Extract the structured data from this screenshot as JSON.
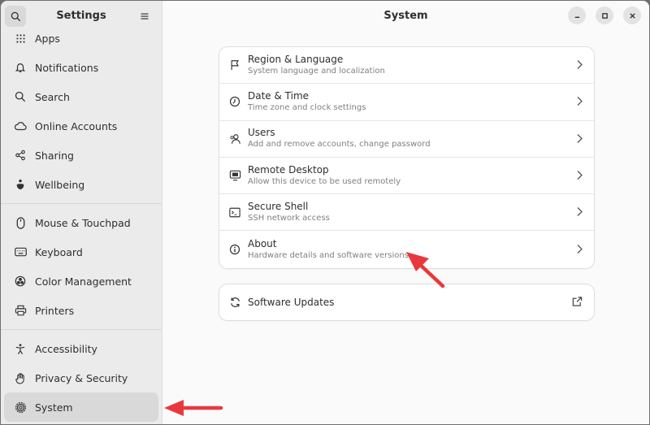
{
  "sidebar": {
    "title": "Settings",
    "items": [
      {
        "label": "Apps",
        "icon": "apps-grid-icon"
      },
      {
        "label": "Notifications",
        "icon": "bell-icon"
      },
      {
        "label": "Search",
        "icon": "search-icon"
      },
      {
        "label": "Online Accounts",
        "icon": "cloud-icon"
      },
      {
        "label": "Sharing",
        "icon": "share-icon"
      },
      {
        "label": "Wellbeing",
        "icon": "wellbeing-icon"
      },
      {
        "label": "Mouse & Touchpad",
        "icon": "mouse-icon"
      },
      {
        "label": "Keyboard",
        "icon": "keyboard-icon"
      },
      {
        "label": "Color Management",
        "icon": "color-icon"
      },
      {
        "label": "Printers",
        "icon": "printer-icon"
      },
      {
        "label": "Accessibility",
        "icon": "accessibility-icon"
      },
      {
        "label": "Privacy & Security",
        "icon": "hand-icon"
      },
      {
        "label": "System",
        "icon": "gear-icon"
      }
    ],
    "active": "System"
  },
  "main": {
    "title": "System",
    "rows": [
      {
        "title": "Region & Language",
        "subtitle": "System language and localization"
      },
      {
        "title": "Date & Time",
        "subtitle": "Time zone and clock settings"
      },
      {
        "title": "Users",
        "subtitle": "Add and remove accounts, change password"
      },
      {
        "title": "Remote Desktop",
        "subtitle": "Allow this device to be used remotely"
      },
      {
        "title": "Secure Shell",
        "subtitle": "SSH network access"
      },
      {
        "title": "About",
        "subtitle": "Hardware details and software versions"
      }
    ],
    "updates_label": "Software Updates"
  },
  "colors": {
    "annotation_arrow": "#e8383d",
    "sidebar_bg": "#ebebeb",
    "active_item_bg": "#d9d9d9"
  }
}
